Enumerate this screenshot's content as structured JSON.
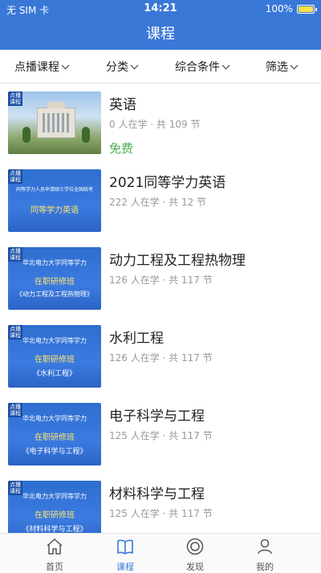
{
  "status_bar": {
    "carrier": "无 SIM 卡",
    "time": "14:21",
    "battery": "100%"
  },
  "header": {
    "title": "课程"
  },
  "filters": [
    {
      "label": "点播课程"
    },
    {
      "label": "分类"
    },
    {
      "label": "综合条件"
    },
    {
      "label": "筛选"
    }
  ],
  "courses": [
    {
      "title": "英语",
      "meta": "0 人在学 · 共 109 节",
      "price": "免费"
    },
    {
      "title": "2021同等学力英语",
      "meta": "222 人在学 · 共 12 节",
      "thumb_lines": [
        "同等学力人员申请硕士学位全国统考",
        "同等学力英语"
      ]
    },
    {
      "title": "动力工程及工程热物理",
      "meta": "126 人在学 · 共 117 节",
      "thumb_lines": [
        "华北电力大学同等学力",
        "在职研修班",
        "《动力工程及工程热物理》"
      ]
    },
    {
      "title": "水利工程",
      "meta": "126 人在学 · 共 117 节",
      "thumb_lines": [
        "华北电力大学同等学力",
        "在职研修班",
        "《水利工程》"
      ]
    },
    {
      "title": "电子科学与工程",
      "meta": "125 人在学 · 共 117 节",
      "thumb_lines": [
        "华北电力大学同等学力",
        "在职研修班",
        "《电子科学与工程》"
      ]
    },
    {
      "title": "材料科学与工程",
      "meta": "125 人在学 · 共 117 节",
      "thumb_lines": [
        "华北电力大学同等学力",
        "在职研修班",
        "《材料科学与工程》"
      ]
    }
  ],
  "thumb_tag": "点播课程",
  "tabbar": [
    {
      "label": "首页",
      "icon": "home-icon"
    },
    {
      "label": "课程",
      "icon": "book-icon"
    },
    {
      "label": "发现",
      "icon": "compass-icon"
    },
    {
      "label": "我的",
      "icon": "person-icon"
    }
  ],
  "accent_color": "#3a78d8"
}
